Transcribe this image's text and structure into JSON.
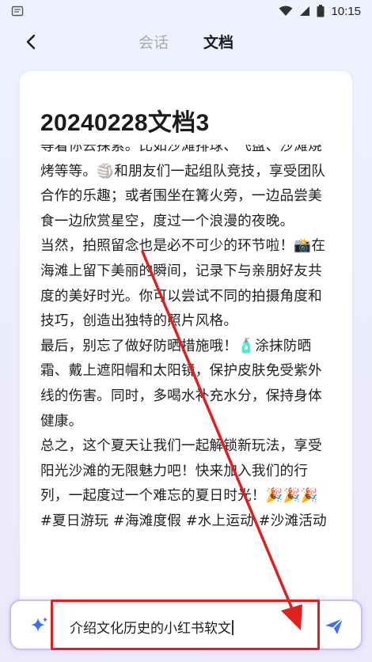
{
  "status_bar": {
    "time": "10:15"
  },
  "header": {
    "tab_chat": "会话",
    "tab_doc": "文档"
  },
  "document": {
    "title": "20240228文档3",
    "paragraphs": [
      "等着你去探索。比如沙滩排球、飞盘、沙滩烧烤等等。🏐和朋友们一起组队竞技，享受团队合作的乐趣；或者围坐在篝火旁，一边品尝美食一边欣赏星空，度过一个浪漫的夜晚。",
      "当然，拍照留念也是必不可少的环节啦！📸在海滩上留下美丽的瞬间，记录下与亲朋好友共度的美好时光。你可以尝试不同的拍摄角度和技巧，创造出独特的照片风格。",
      "最后，别忘了做好防晒措施哦！🧴涂抹防晒霜、戴上遮阳帽和太阳镜，保护皮肤免受紫外线的伤害。同时，多喝水补充水分，保持身体健康。",
      "总之，这个夏天让我们一起解锁新玩法，享受阳光沙滩的无限魅力吧！快来加入我们的行列，一起度过一个难忘的夏日时光！🎉🎉🎉",
      "#夏日游玩 #海滩度假 #水上运动 #沙滩活动"
    ]
  },
  "input": {
    "value": "介绍文化历史的小红书软文"
  },
  "colors": {
    "accent": "#3b6ef5",
    "highlight": "#e0201c",
    "input_border": "#c7bff5"
  },
  "icons": {
    "back": "chevron-left-icon",
    "sparkle": "sparkle-icon",
    "send": "send-icon"
  }
}
